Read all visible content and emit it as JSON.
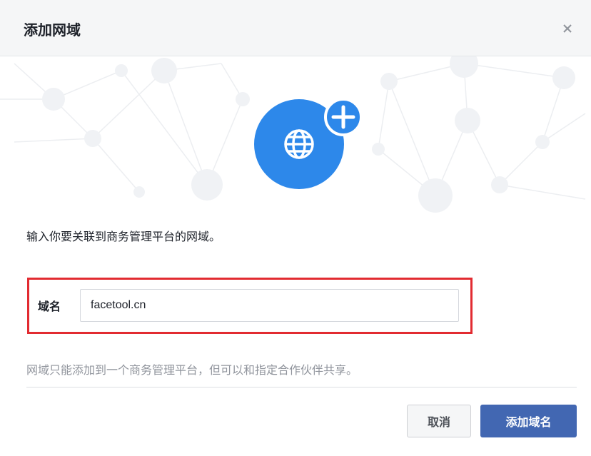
{
  "dialog": {
    "title": "添加网域",
    "close_icon": "close-icon",
    "description": "输入你要关联到商务管理平台的网域。",
    "field": {
      "label": "域名",
      "value": "facetool.cn",
      "placeholder": ""
    },
    "note": "网域只能添加到一个商务管理平台，但可以和指定合作伙伴共享。",
    "buttons": {
      "cancel": "取消",
      "add": "添加域名"
    }
  },
  "colors": {
    "primary": "#4267b2",
    "icon_blue": "#2d88ea",
    "highlight_red": "#e22b31"
  },
  "icons": {
    "hero": "globe-icon",
    "badge": "plus-icon"
  }
}
